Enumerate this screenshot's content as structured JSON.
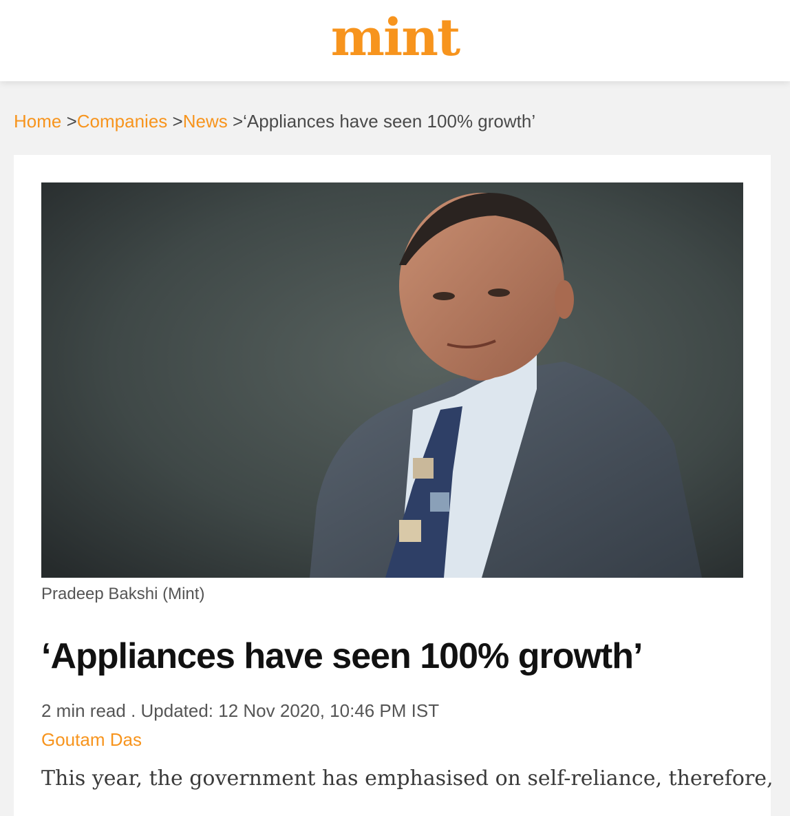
{
  "brand": {
    "logo_text": "mint",
    "accent_color": "#f7941d"
  },
  "breadcrumb": {
    "items": [
      {
        "label": "Home",
        "link": true
      },
      {
        "label": "Companies",
        "link": true
      },
      {
        "label": "News",
        "link": true
      },
      {
        "label": "‘Appliances have seen 100% growth’",
        "link": false
      }
    ],
    "separator": ">"
  },
  "article": {
    "image_caption": "Pradeep Bakshi (Mint)",
    "headline": "‘Appliances have seen 100% growth’",
    "meta": "2 min read . Updated: 12 Nov 2020, 10:46 PM IST",
    "author": "Goutam Das",
    "body_first_line": "This year, the government has emphasised on self-reliance, therefore,"
  },
  "icons": {
    "hero_image": "portrait-photo"
  }
}
